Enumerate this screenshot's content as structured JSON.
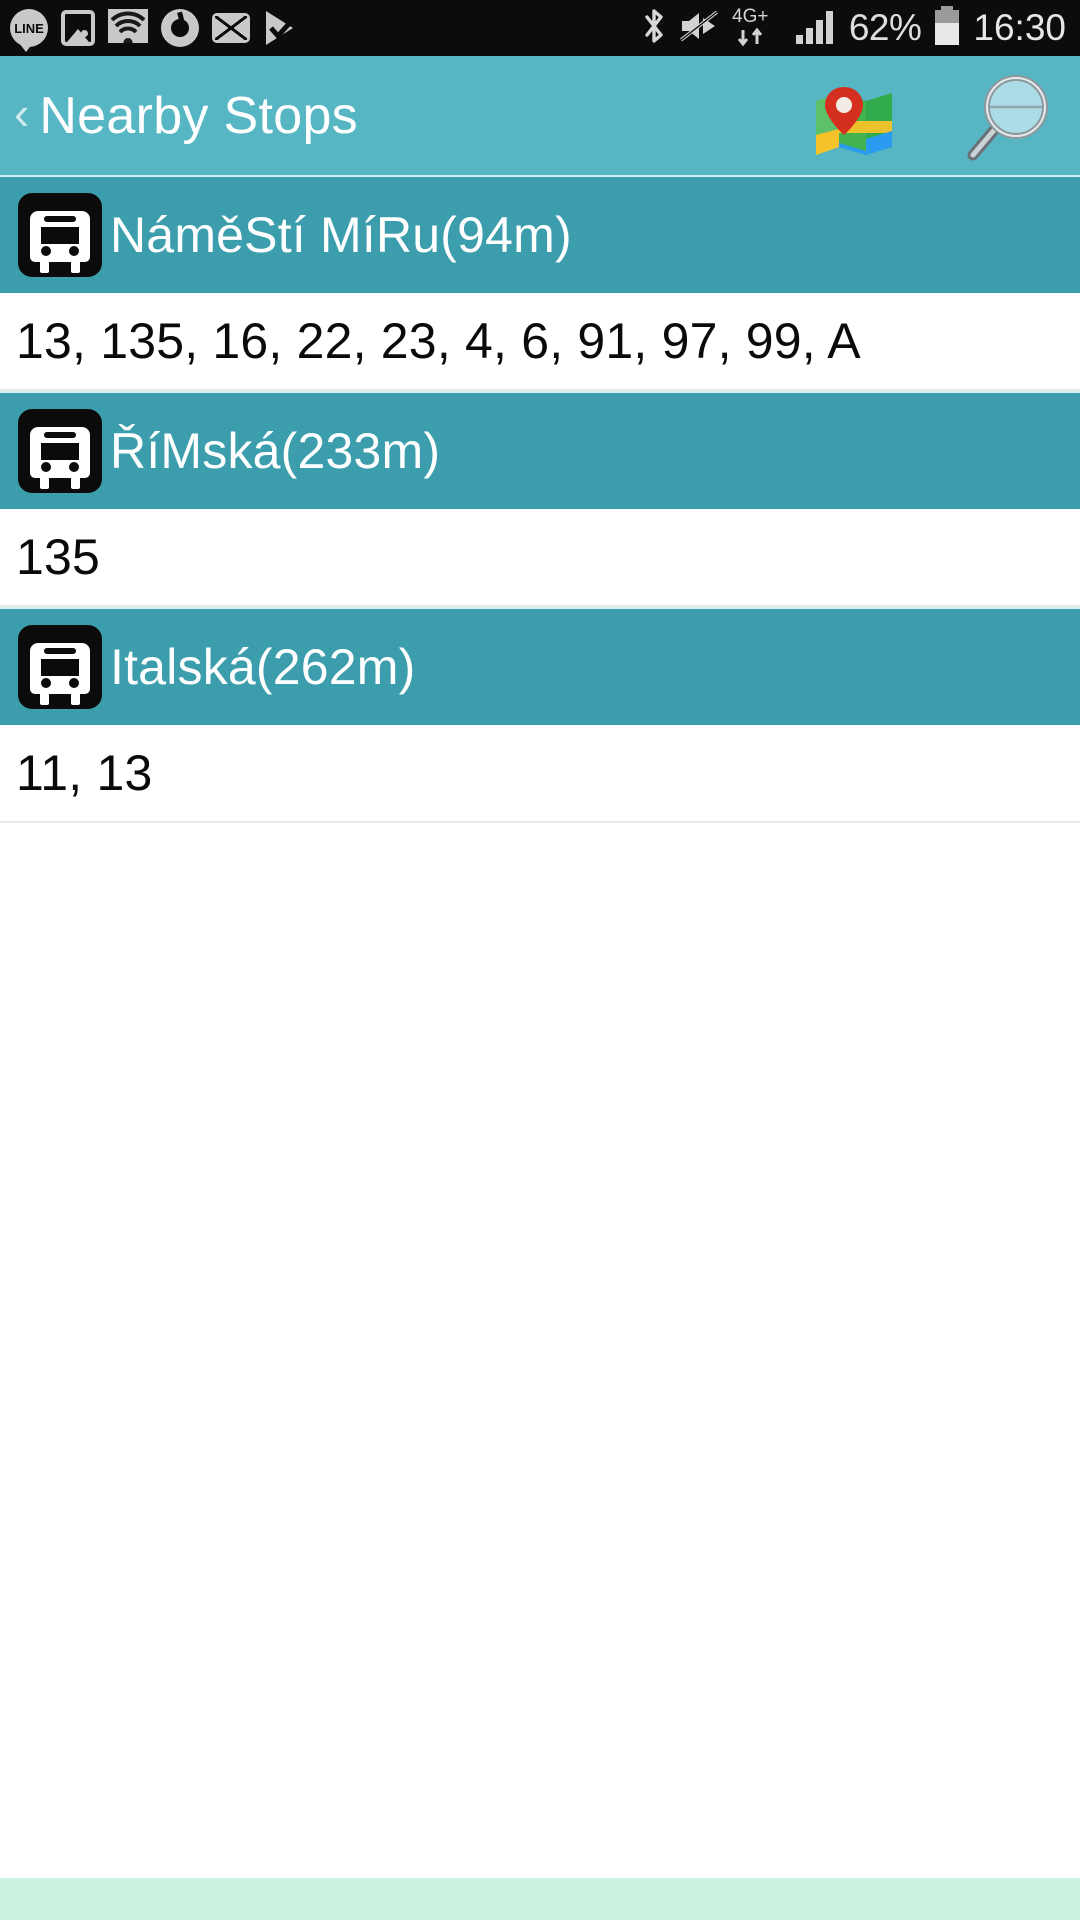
{
  "status_bar": {
    "left_icons": [
      {
        "name": "line-app-icon",
        "label": "LINE"
      },
      {
        "name": "gallery-icon",
        "label": ""
      },
      {
        "name": "wifi-icon",
        "label": ""
      },
      {
        "name": "chrome-icon",
        "label": ""
      },
      {
        "name": "mail-icon",
        "label": ""
      },
      {
        "name": "play-store-checkmark-icon",
        "label": ""
      }
    ],
    "right_icons": [
      {
        "name": "bluetooth-icon"
      },
      {
        "name": "mute-icon"
      },
      {
        "name": "network-4g-plus-icon"
      },
      {
        "name": "signal-bars-icon"
      },
      {
        "name": "battery-icon"
      }
    ],
    "network_label": "4G+",
    "battery_percent": "62%",
    "clock": "16:30"
  },
  "app_bar": {
    "back_glyph": "‹",
    "title": "Nearby Stops",
    "map_icon_name": "map-icon",
    "search_icon_name": "search-icon"
  },
  "stops": [
    {
      "name": "NáměStí MíRu(94m)",
      "routes": "13, 135, 16, 22, 23, 4, 6, 91, 97, 99, A",
      "icon": "bus-icon"
    },
    {
      "name": "ŘíMská(233m)",
      "routes": "135",
      "icon": "bus-icon"
    },
    {
      "name": "Italská(262m)",
      "routes": "11, 13",
      "icon": "bus-icon"
    }
  ],
  "colors": {
    "status_bar_bg": "#0c0c0c",
    "app_bar_bg": "#56b6c3",
    "stop_header_bg": "#3c9dad",
    "routes_bg": "#ffffff",
    "bottom_strip_bg": "#c9f2e1",
    "title_text": "#ffffff",
    "routes_text": "#0a0a0a"
  }
}
